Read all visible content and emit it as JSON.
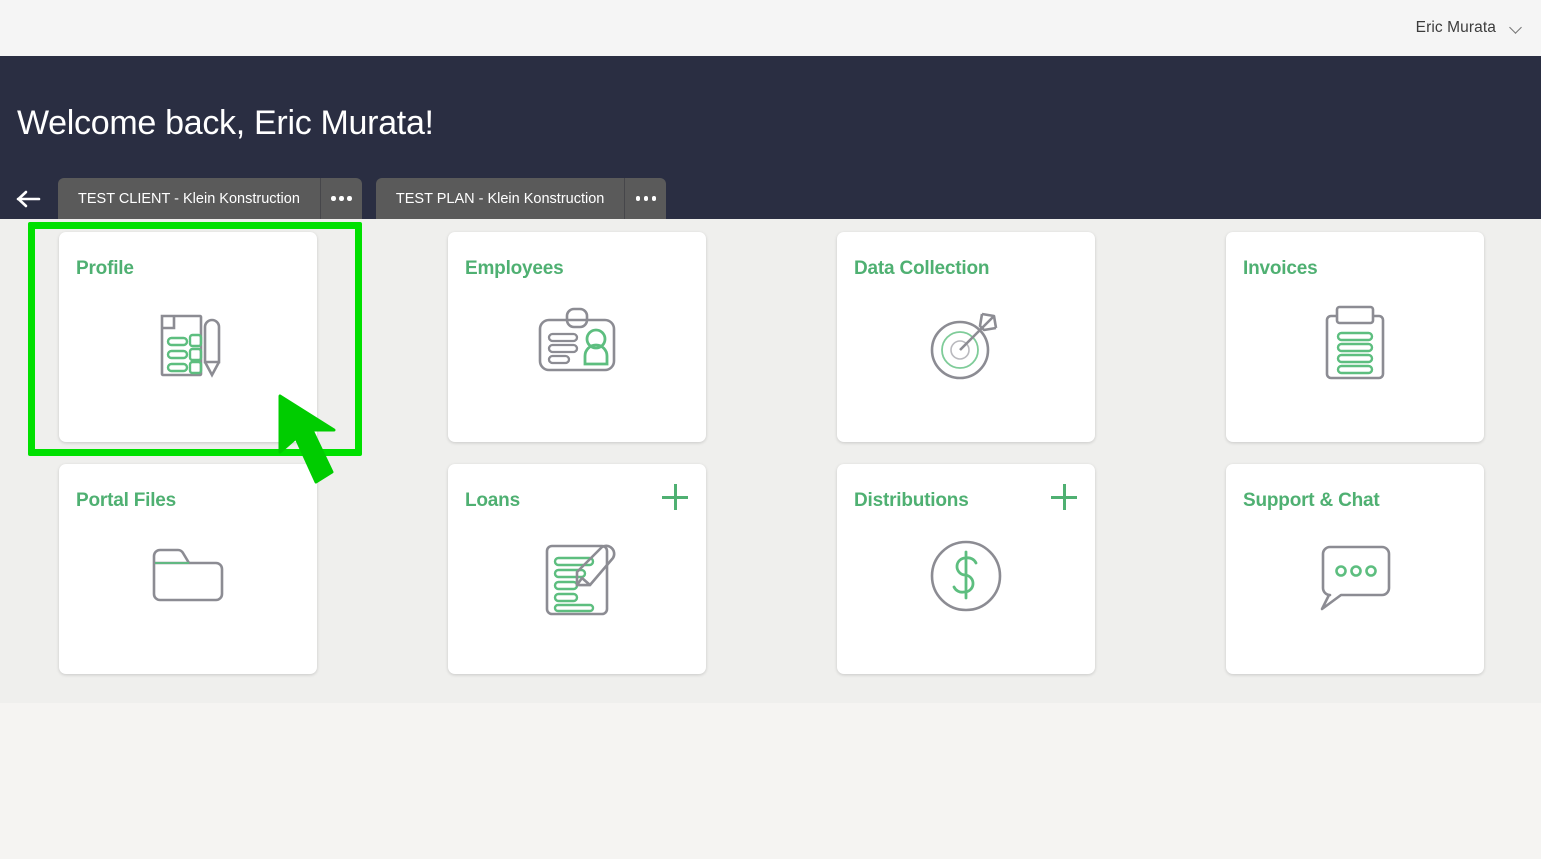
{
  "topbar": {
    "user_name": "Eric Murata",
    "chevron_icon": "chevron-down-icon"
  },
  "hero": {
    "welcome_text": "Welcome back, Eric Murata!"
  },
  "tabstrip": {
    "back_icon": "arrow-left-icon",
    "tabs": [
      {
        "label": "TEST CLIENT - Klein Konstruction",
        "more_icon": "ellipsis-icon"
      },
      {
        "label": "TEST PLAN - Klein Konstruction",
        "more_icon": "ellipsis-icon"
      }
    ]
  },
  "cards": [
    {
      "title": "Profile",
      "icon": "document-pencil-icon",
      "has_plus": false,
      "highlighted": true
    },
    {
      "title": "Employees",
      "icon": "id-badge-icon",
      "has_plus": false,
      "highlighted": false
    },
    {
      "title": "Data Collection",
      "icon": "target-arrow-icon",
      "has_plus": false,
      "highlighted": false
    },
    {
      "title": "Invoices",
      "icon": "clipboard-icon",
      "has_plus": false,
      "highlighted": false
    },
    {
      "title": "Portal Files",
      "icon": "folder-icon",
      "has_plus": false,
      "highlighted": false
    },
    {
      "title": "Loans",
      "icon": "document-edit-icon",
      "has_plus": true,
      "plus_label": "+",
      "highlighted": false
    },
    {
      "title": "Distributions",
      "icon": "dollar-circle-icon",
      "has_plus": true,
      "plus_label": "+",
      "highlighted": false
    },
    {
      "title": "Support & Chat",
      "icon": "chat-bubble-icon",
      "has_plus": false,
      "highlighted": false
    }
  ],
  "annotation": {
    "highlight_color": "#00e000",
    "cursor_color": "#00d400",
    "cursor_icon": "mouse-pointer-arrow"
  },
  "colors": {
    "hero_bg": "#2a2e42",
    "topbar_bg": "#f5f5f5",
    "panel_bg": "#efefed",
    "page_bg": "#f5f4f2",
    "tab_bg": "#5a5a5a",
    "accent_green": "#4fb072",
    "icon_gray": "#8c8c93"
  }
}
